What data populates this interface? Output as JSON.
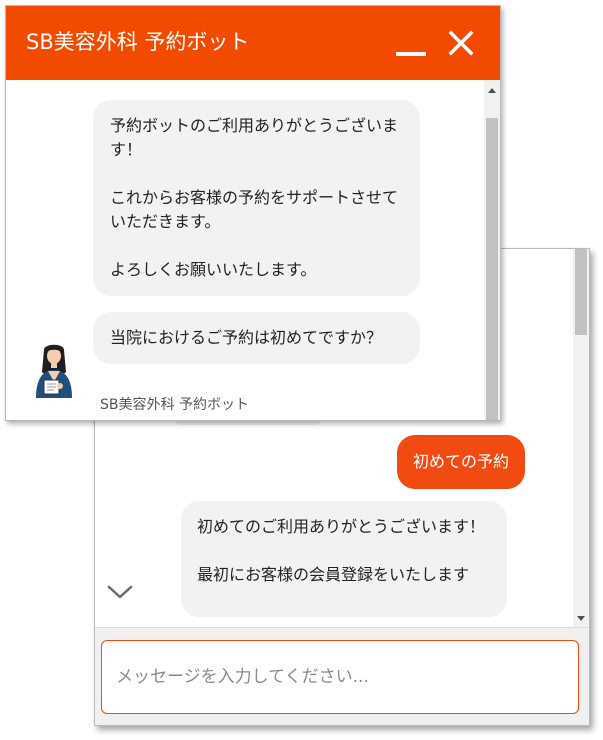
{
  "colors": {
    "accent": "#f24b00",
    "user_bubble": "#f24b12",
    "bot_bubble": "#f2f2f2"
  },
  "front_window": {
    "title": "SB美容外科 予約ボット",
    "minimize_icon": "minimize-icon",
    "close_icon": "close-icon",
    "messages": [
      {
        "text": "予約ボットのご利用ありがとうございます！\n\nこれからお客様の予約をサポートさせていただきます。\n\nよろしくお願いいたします。"
      },
      {
        "text": "当院におけるご予約は初めてですか？"
      }
    ],
    "sender_label": "SB美容外科 予約ボット",
    "avatar_icon": "bot-avatar-icon"
  },
  "back_window": {
    "user_reply": "初めての予約",
    "bot_message": "初めてのご利用ありがとうございます！\n\n最初にお客様の会員登録をいたします",
    "scroll_down_icon": "chevron-down-icon",
    "input_placeholder": "メッセージを入力してください..."
  }
}
